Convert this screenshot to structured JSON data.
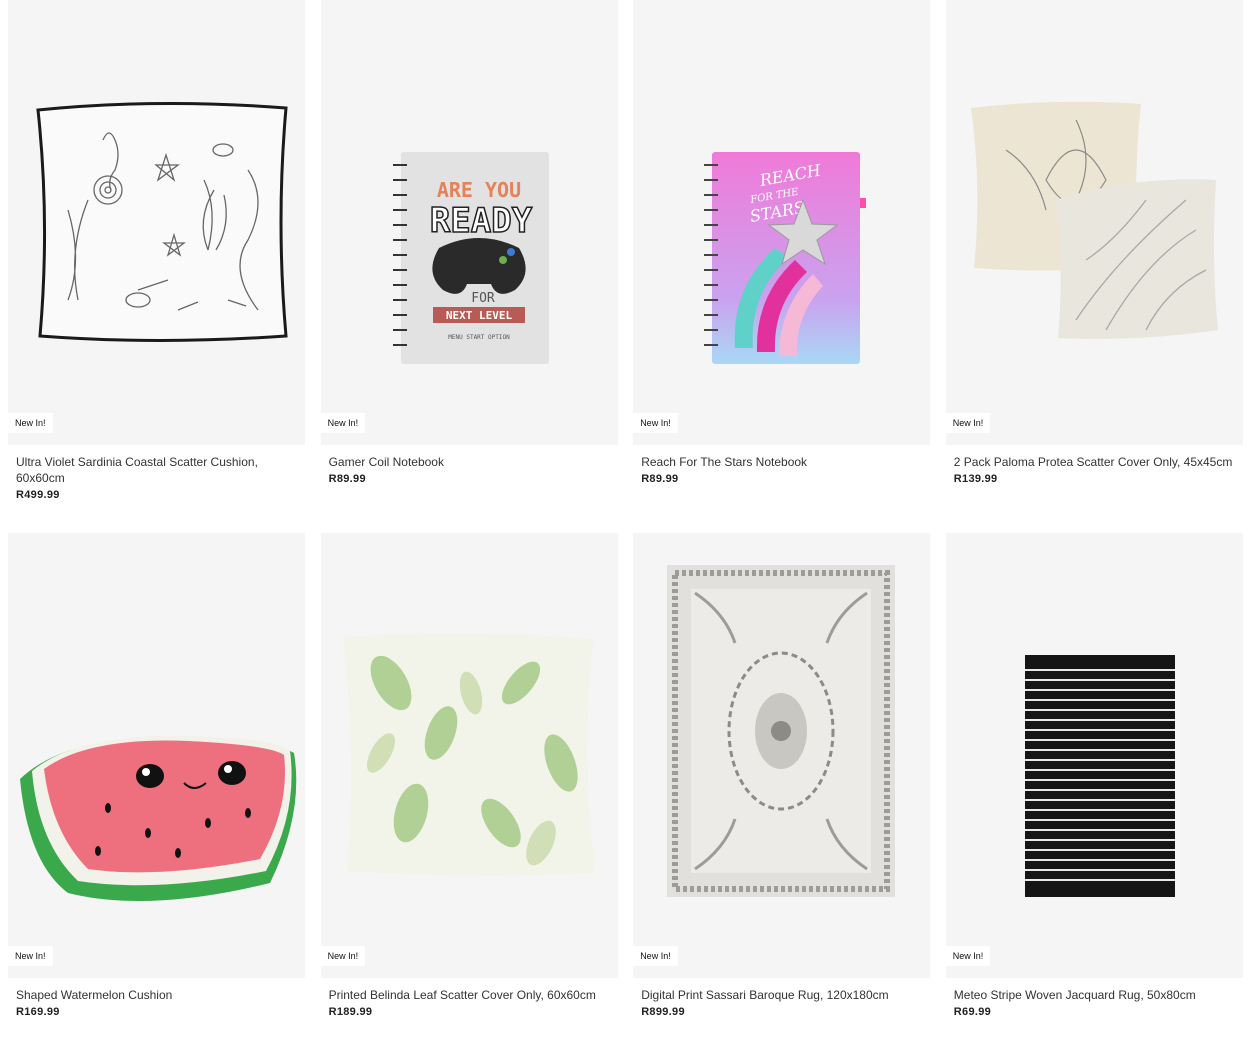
{
  "products": [
    {
      "badge": "New In!",
      "title": "Ultra Violet Sardinia Coastal Scatter Cushion, 60x60cm",
      "price": "R499.99",
      "image": "coastal-cushion-image"
    },
    {
      "badge": "New In!",
      "title": "Gamer Coil Notebook",
      "price": "R89.99",
      "image": "gamer-notebook-image",
      "image_text": {
        "line1": "ARE YOU",
        "line2": "READY",
        "line3": "FOR",
        "line4": "NEXT LEVEL",
        "line5": "MENU  START  OPTION"
      }
    },
    {
      "badge": "New In!",
      "title": "Reach For The Stars Notebook",
      "price": "R89.99",
      "image": "stars-notebook-image",
      "image_text": {
        "line1": "REACH",
        "line2": "FOR THE",
        "line3": "STARS"
      }
    },
    {
      "badge": "New In!",
      "title": "2 Pack Paloma Protea Scatter Cover Only, 45x45cm",
      "price": "R139.99",
      "image": "protea-cushions-image"
    },
    {
      "badge": "New In!",
      "title": "Shaped Watermelon Cushion",
      "price": "R169.99",
      "image": "watermelon-cushion-image"
    },
    {
      "badge": "New In!",
      "title": "Printed Belinda Leaf Scatter Cover Only, 60x60cm",
      "price": "R189.99",
      "image": "leaf-cushion-image"
    },
    {
      "badge": "New In!",
      "title": "Digital Print Sassari Baroque Rug, 120x180cm",
      "price": "R899.99",
      "image": "baroque-rug-image"
    },
    {
      "badge": "New In!",
      "title": "Meteo Stripe Woven Jacquard Rug, 50x80cm",
      "price": "R69.99",
      "image": "stripe-rug-image"
    }
  ],
  "colors": {
    "card_bg": "#f5f5f5",
    "badge_bg": "#ffffff",
    "price": "#222222"
  }
}
